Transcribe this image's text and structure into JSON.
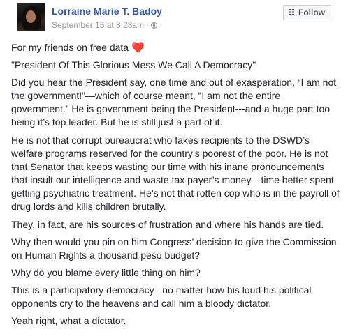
{
  "author": {
    "name": "Lorraine Marie T. Badoy",
    "timestamp": "September 15 at 8:28am",
    "separator": "·",
    "privacy_icon": "globe-icon"
  },
  "follow_button": {
    "label": "Follow",
    "icon": "rss-icon"
  },
  "post": {
    "intro": "For my friends on free data",
    "intro_emoji": "❤️",
    "title": "\"President Of This Glorious Mess We Call A Democracy\"",
    "paragraphs": [
      "Did you hear the President say, one time and out of exasperation, “I am not the government!”—which of course meant, “I am not the entire government.” He is government being the President---and a huge part too being it’s top leader. But he is still just a part of it.",
      "He is not that corrupt bureaucrat who fakes recipients to the DSWD’s welfare programs reserved for the country’s poorest of the poor. He is not that Senator that keeps wasting our time with his inane pronouncements that insult our intelligence and waste tax payer’s money—time better spent getting psychiatric treatment. He’s not that rotten cop who is in the payroll of drug lords and kills children brutally.",
      "They, in fact, are his sources of frustration and where his hands are tied.",
      "Why then would you pin on him Congress’ decision to give the Commission on Human Rights a thousand peso budget?",
      "Why do you blame every little thing on him?",
      "This is a participatory democracy –no matter how his loud his political opponents cry to the heavens and call him a bloody dictator.",
      "Yeah right, what a dictator."
    ]
  }
}
